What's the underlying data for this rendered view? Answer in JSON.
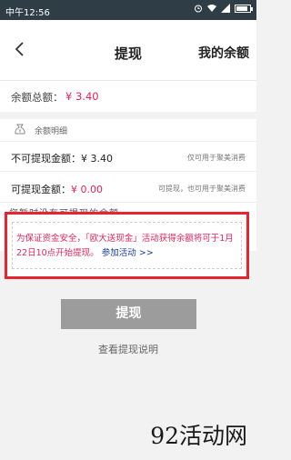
{
  "status_bar": {
    "time": "中午12:56"
  },
  "header": {
    "title": "提现",
    "right_link": "我的余额"
  },
  "balance": {
    "label": "余额总额：",
    "value": "¥ 3.40"
  },
  "detail": {
    "title": "余额明细",
    "rows": [
      {
        "label": "不可提现金额：",
        "amount": "¥ 3.40",
        "hint": "仅可用于聚美消费",
        "amount_color": "#222222"
      },
      {
        "label": "可提现金额：",
        "amount": "¥ 0.00",
        "hint": "可提现，也可用于聚美消费",
        "amount_color": "#e6245a"
      }
    ],
    "cutoff_text": "您暂时没有可提现的余额"
  },
  "notice": {
    "text": "为保证资金安全，「欧大送现金」活动获得余额将可于1月22日10点开始提现。",
    "link": "参加活动 >>"
  },
  "withdraw_button": "提现",
  "explain_link": "查看提现说明",
  "watermark": "92活动网",
  "colors": {
    "accent_pink": "#e6245a",
    "notice_border": "#e8242f",
    "button_gray": "#9c9c9c",
    "link_blue": "#1a3d9c"
  }
}
